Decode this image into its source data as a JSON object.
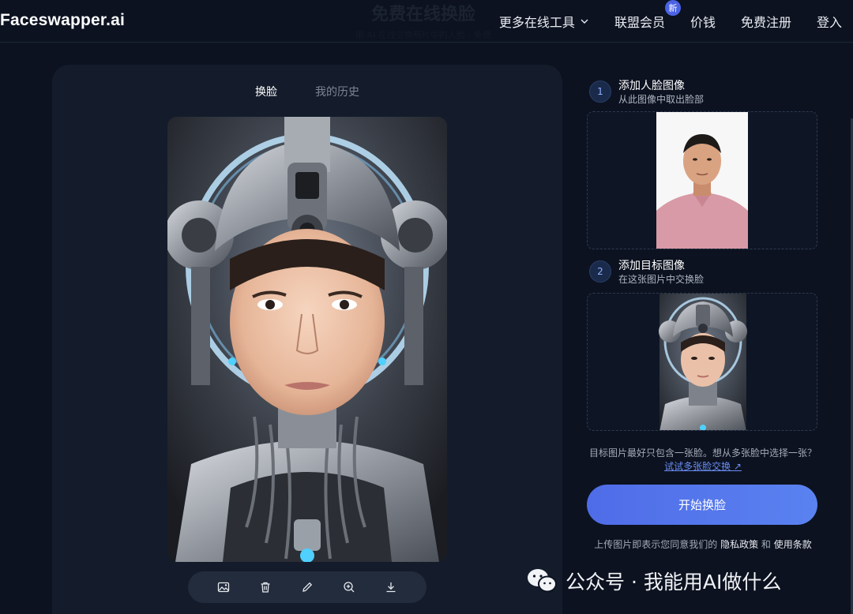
{
  "header": {
    "logo": "Faceswapper.ai",
    "nav": [
      {
        "label": "更多在线工具",
        "has_chevron": true
      },
      {
        "label": "联盟会员",
        "badge": "新"
      },
      {
        "label": "价钱"
      },
      {
        "label": "免费注册"
      },
      {
        "label": "登入"
      }
    ],
    "ghost_title": "免费在线换脸",
    "ghost_sub": "用 AI 在线交换照片中的人脸 - 免费"
  },
  "left_panel": {
    "tabs": [
      {
        "label": "换脸",
        "active": true
      },
      {
        "label": "我的历史",
        "active": false
      }
    ],
    "toolbar_icons": [
      "image-icon",
      "trash-icon",
      "pencil-icon",
      "zoom-in-icon",
      "download-icon"
    ]
  },
  "steps": [
    {
      "number": "1",
      "title": "添加人脸图像",
      "subtitle": "从此图像中取出脸部"
    },
    {
      "number": "2",
      "title": "添加目标图像",
      "subtitle": "在这张图片中交换脸"
    }
  ],
  "note": {
    "text": "目标图片最好只包含一张脸。想从多张脸中选择一张？",
    "link": "试试多张脸交换 ↗"
  },
  "start_button": "开始换脸",
  "terms": {
    "prefix": "上传图片即表示您同意我们的",
    "privacy": "隐私政策",
    "and": "和",
    "usage": "使用条款"
  },
  "watermark": "公众号 · 我能用AI做什么",
  "colors": {
    "background": "#0c1220",
    "panel": "#141c2b",
    "accent": "#5270ea",
    "link": "#6a8df2"
  }
}
